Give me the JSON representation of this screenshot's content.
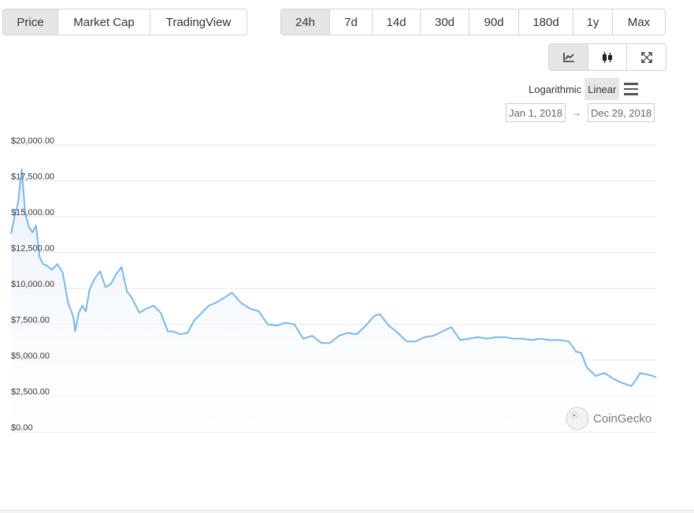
{
  "metric_tabs": [
    {
      "label": "Price",
      "active": true
    },
    {
      "label": "Market Cap",
      "active": false
    },
    {
      "label": "TradingView",
      "active": false
    }
  ],
  "range_tabs": [
    {
      "label": "24h",
      "active": true
    },
    {
      "label": "7d",
      "active": false
    },
    {
      "label": "14d",
      "active": false
    },
    {
      "label": "30d",
      "active": false
    },
    {
      "label": "90d",
      "active": false
    },
    {
      "label": "180d",
      "active": false
    },
    {
      "label": "1y",
      "active": false
    },
    {
      "label": "Max",
      "active": false
    }
  ],
  "view_buttons": [
    {
      "icon": "line-chart-icon",
      "active": true
    },
    {
      "icon": "candlestick-icon",
      "active": false
    },
    {
      "icon": "fullscreen-icon",
      "active": false
    }
  ],
  "scale": {
    "logarithmic": "Logarithmic",
    "linear": "Linear",
    "active": "linear"
  },
  "date_range": {
    "from": "Jan 1, 2018",
    "arrow": "→",
    "to": "Dec 29, 2018"
  },
  "watermark": "CoinGecko",
  "colors": {
    "line": "#7cb5ec",
    "fill_top": "#e9f1fb",
    "grid": "#e6e6e6"
  },
  "chart_data": {
    "type": "area",
    "ylim": [
      0,
      20000
    ],
    "y_ticks": [
      0,
      2500,
      5000,
      7500,
      10000,
      12500,
      15000,
      17500,
      20000
    ],
    "y_tick_labels": [
      "$0.00",
      "$2,500.00",
      "$5,000.00",
      "$7,500.00",
      "$10,000.00",
      "$12,500.00",
      "$15,000.00",
      "$17,500.00",
      "$20,000.00"
    ],
    "x_range": [
      "2018-01-01",
      "2018-12-29"
    ],
    "series": [
      {
        "x": [
          "2018-01-01",
          "2018-01-03",
          "2018-01-05",
          "2018-01-07",
          "2018-01-09",
          "2018-01-11",
          "2018-01-13",
          "2018-01-15",
          "2018-01-17",
          "2018-01-19",
          "2018-01-21",
          "2018-01-24",
          "2018-01-27",
          "2018-01-30",
          "2018-02-02",
          "2018-02-05",
          "2018-02-06",
          "2018-02-08",
          "2018-02-10",
          "2018-02-12",
          "2018-02-14",
          "2018-02-17",
          "2018-02-20",
          "2018-02-23",
          "2018-02-26",
          "2018-03-01",
          "2018-03-04",
          "2018-03-07",
          "2018-03-10",
          "2018-03-14",
          "2018-03-18",
          "2018-03-22",
          "2018-03-26",
          "2018-03-30",
          "2018-04-02",
          "2018-04-06",
          "2018-04-10",
          "2018-04-14",
          "2018-04-18",
          "2018-04-22",
          "2018-04-26",
          "2018-04-30",
          "2018-05-05",
          "2018-05-10",
          "2018-05-15",
          "2018-05-20",
          "2018-05-25",
          "2018-05-30",
          "2018-06-04",
          "2018-06-09",
          "2018-06-14",
          "2018-06-19",
          "2018-06-24",
          "2018-06-29",
          "2018-07-04",
          "2018-07-09",
          "2018-07-14",
          "2018-07-19",
          "2018-07-24",
          "2018-07-27",
          "2018-08-01",
          "2018-08-06",
          "2018-08-11",
          "2018-08-16",
          "2018-08-21",
          "2018-08-26",
          "2018-08-31",
          "2018-09-05",
          "2018-09-10",
          "2018-09-15",
          "2018-09-20",
          "2018-09-25",
          "2018-09-30",
          "2018-10-05",
          "2018-10-10",
          "2018-10-15",
          "2018-10-20",
          "2018-10-25",
          "2018-10-30",
          "2018-11-05",
          "2018-11-10",
          "2018-11-14",
          "2018-11-17",
          "2018-11-20",
          "2018-11-25",
          "2018-11-30",
          "2018-12-05",
          "2018-12-10",
          "2018-12-15",
          "2018-12-18",
          "2018-12-20",
          "2018-12-24",
          "2018-12-27",
          "2018-12-29"
        ],
        "values": [
          13800,
          15000,
          16000,
          18300,
          15200,
          14300,
          13900,
          14400,
          12200,
          11700,
          11600,
          11300,
          11700,
          11100,
          9000,
          8000,
          7000,
          8300,
          8800,
          8400,
          9900,
          10700,
          11200,
          10100,
          10300,
          11000,
          11500,
          9800,
          9300,
          8300,
          8600,
          8800,
          8300,
          7000,
          7000,
          6800,
          6900,
          7800,
          8300,
          8800,
          9000,
          9300,
          9700,
          9000,
          8600,
          8400,
          7500,
          7400,
          7600,
          7500,
          6500,
          6700,
          6200,
          6200,
          6700,
          6900,
          6800,
          7400,
          8100,
          8200,
          7400,
          6900,
          6300,
          6300,
          6600,
          6700,
          7000,
          7300,
          6400,
          6500,
          6600,
          6500,
          6600,
          6600,
          6500,
          6500,
          6400,
          6500,
          6400,
          6400,
          6300,
          5600,
          5500,
          4500,
          3900,
          4100,
          3700,
          3400,
          3200,
          3700,
          4100,
          4000,
          3900,
          3800
        ]
      }
    ]
  }
}
